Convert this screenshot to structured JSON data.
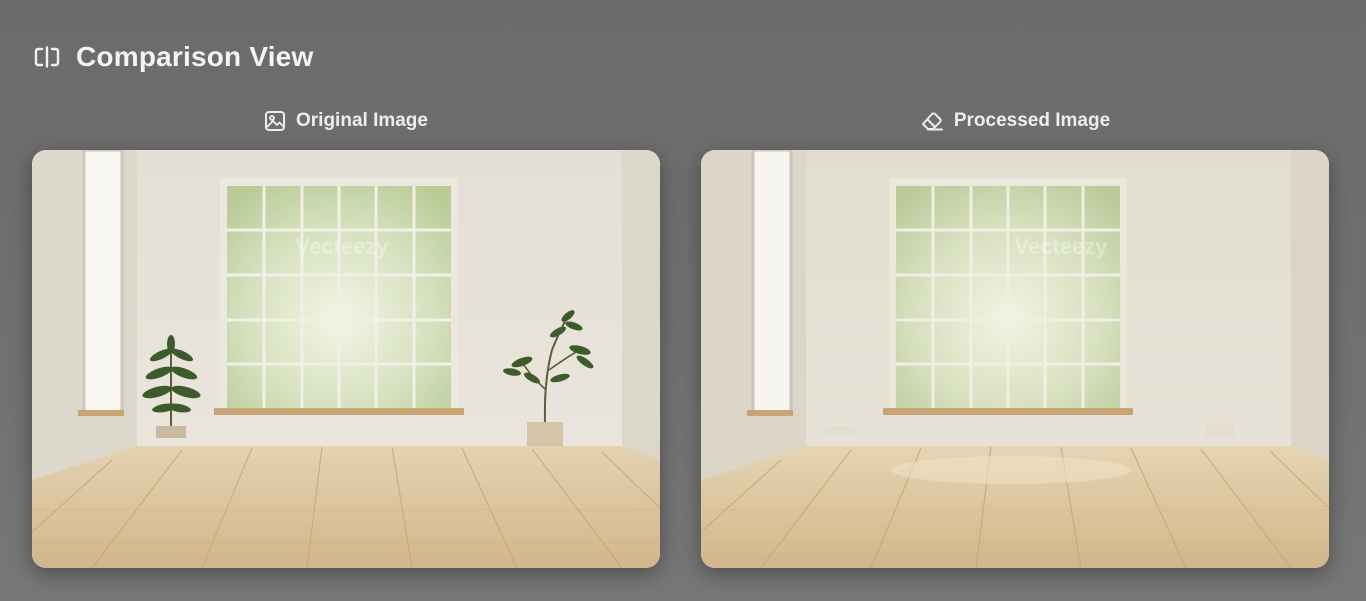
{
  "header": {
    "title": "Comparison View",
    "icon": "compare-icon"
  },
  "panels": [
    {
      "label": "Original Image",
      "icon": "image-icon",
      "watermark": "Vecteezy",
      "image_description": "bright empty room with large window and two potted plants on light wood floor"
    },
    {
      "label": "Processed Image",
      "icon": "eraser-icon",
      "watermark": "Vecteezy",
      "image_description": "same room with the potted plants removed"
    }
  ],
  "colors": {
    "background": "#6f6f6f",
    "text": "#f2f2f2",
    "wall": "#e9e5dc",
    "floor": "#d9bf96"
  }
}
